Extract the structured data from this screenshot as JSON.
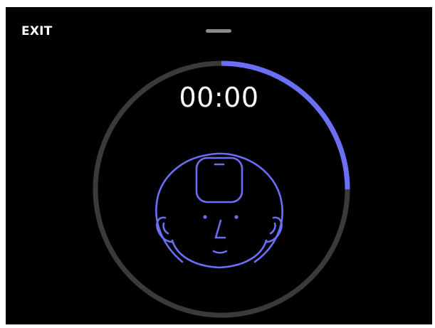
{
  "header": {
    "exit_label": "EXIT"
  },
  "timer": {
    "display": "00:00",
    "progress_fraction": 0.25
  },
  "illustration": {
    "icon": "head-with-device-icon"
  },
  "colors": {
    "background": "#000000",
    "accent": "#6b6ff5",
    "track": "#3a3a3a",
    "text": "#ffffff",
    "handle": "#8a8a8a"
  }
}
